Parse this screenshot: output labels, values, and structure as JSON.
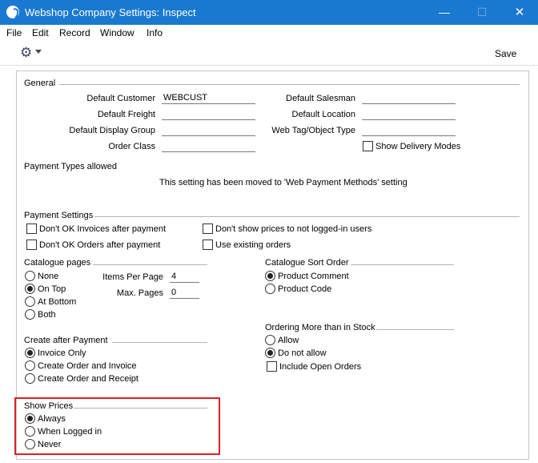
{
  "window": {
    "title": "Webshop Company Settings: Inspect",
    "min_glyph": "—",
    "max_glyph": "☐",
    "close_glyph": "✕"
  },
  "menu": [
    "File",
    "Edit",
    "Record",
    "Window",
    "Info"
  ],
  "toolbar": {
    "gear_glyph": "⚙",
    "save_label": "Save"
  },
  "general": {
    "title": "General",
    "default_customer_label": "Default Customer",
    "default_customer_value": "WEBCUST",
    "default_freight_label": "Default Freight",
    "default_freight_value": "",
    "default_display_group_label": "Default Display Group",
    "default_display_group_value": "",
    "order_class_label": "Order Class",
    "order_class_value": "",
    "default_salesman_label": "Default Salesman",
    "default_salesman_value": "",
    "default_location_label": "Default Location",
    "default_location_value": "",
    "web_tag_label": "Web Tag/Object Type",
    "web_tag_value": "",
    "show_delivery_modes_label": "Show Delivery Modes",
    "show_delivery_modes_checked": false
  },
  "payment_types": {
    "title": "Payment Types allowed",
    "message": "This setting has been moved to 'Web Payment Methods' setting"
  },
  "payment_settings": {
    "title": "Payment Settings",
    "dont_ok_invoices_label": "Don't OK Invoices after payment",
    "dont_ok_invoices_checked": false,
    "dont_ok_orders_label": "Don't OK Orders after payment",
    "dont_ok_orders_checked": false,
    "dont_show_prices_label": "Don't show prices to not logged-in users",
    "dont_show_prices_checked": false,
    "use_existing_orders_label": "Use existing orders",
    "use_existing_orders_checked": false
  },
  "catalogue_pages": {
    "title": "Catalogue pages",
    "options": [
      "None",
      "On Top",
      "At Bottom",
      "Both"
    ],
    "selected": "On Top",
    "items_per_page_label": "Items Per Page",
    "items_per_page_value": "4",
    "max_pages_label": "Max. Pages",
    "max_pages_value": "0"
  },
  "catalogue_sort_order": {
    "title": "Catalogue Sort Order",
    "options": [
      "Product Comment",
      "Product Code"
    ],
    "selected": "Product Comment"
  },
  "create_after_payment": {
    "title": "Create after Payment",
    "options": [
      "Invoice Only",
      "Create Order and Invoice",
      "Create Order and Receipt"
    ],
    "selected": "Invoice Only"
  },
  "ordering_more_than_stock": {
    "title": "Ordering More than in Stock",
    "options": [
      "Allow",
      "Do not allow"
    ],
    "selected": "Do not allow",
    "include_open_orders_label": "Include Open Orders",
    "include_open_orders_checked": false
  },
  "show_prices": {
    "title": "Show Prices",
    "options": [
      "Always",
      "When Logged in",
      "Never"
    ],
    "selected": "Always"
  },
  "colors": {
    "titlebar": "#1979d0",
    "highlight": "#d9222a"
  }
}
